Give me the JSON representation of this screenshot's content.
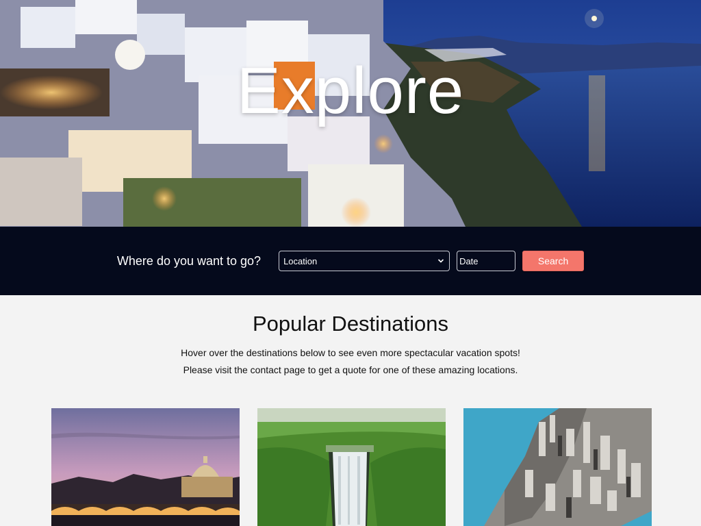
{
  "hero": {
    "title": "Explore"
  },
  "search": {
    "prompt": "Where do you want to go?",
    "location_placeholder": "Location",
    "date_placeholder": "Date",
    "button_label": "Search"
  },
  "popular": {
    "heading": "Popular Destinations",
    "line1": "Hover over the destinations below to see even more spectacular vacation spots!",
    "line2": "Please visit the contact page to get a quote for one of these amazing locations."
  },
  "colors": {
    "search_bar_bg": "#050a1c",
    "search_button": "#f4766b",
    "page_bg": "#f3f3f3"
  },
  "icons": {
    "dropdown": "chevron-down-icon"
  }
}
